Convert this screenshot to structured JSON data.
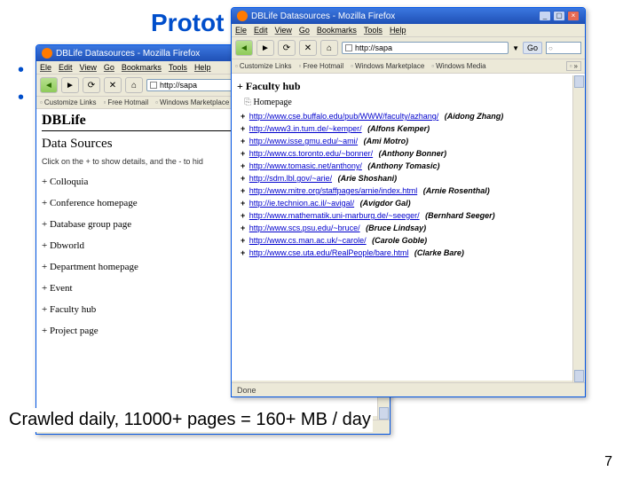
{
  "slide": {
    "title_fragment": "Protot",
    "crawl_text": "Crawled daily, 11000+ pages = 160+ MB / day",
    "page_number": "7"
  },
  "window_shared": {
    "title": "DBLife Datasources - Mozilla Firefox",
    "menu": [
      "Ele",
      "Edit",
      "View",
      "Go",
      "Bookmarks",
      "Tools",
      "Help"
    ],
    "url": "http://sapa",
    "go_label": "Go",
    "bookmarks": [
      "Customize Links",
      "Free Hotmail",
      "Windows Marketplace",
      "Windows Media"
    ],
    "expand": "»",
    "status": "Done"
  },
  "back_window": {
    "dblife": "DBLife",
    "heading": "Data Sources",
    "hint": "Click on the + to show details, and the - to hid",
    "items": [
      "+ Colloquia",
      "+ Conference homepage",
      "+ Database group page",
      "+ Dbworld",
      "+ Department homepage",
      "+ Event",
      "+ Faculty hub",
      "+ Project page"
    ]
  },
  "front_window": {
    "faculty_hub": "+ Faculty hub",
    "homepage": "Homepage",
    "links": [
      {
        "url": "http://www.cse.buffalo.edu/pub/WWW/faculty/azhang/",
        "who": "(Aidong Zhang)"
      },
      {
        "url": "http://www3.in.tum.de/~kemper/",
        "who": "(Alfons Kemper)"
      },
      {
        "url": "http://www.isse.gmu.edu/~ami/",
        "who": "(Ami Motro)"
      },
      {
        "url": "http://www.cs.toronto.edu/~bonner/",
        "who": "(Anthony Bonner)"
      },
      {
        "url": "http://www.tomasic.net/anthony/",
        "who": "(Anthony Tomasic)"
      },
      {
        "url": "http://sdm.lbl.gov/~arie/",
        "who": "(Arie Shoshani)"
      },
      {
        "url": "http://www.mitre.org/staffpages/arnie/index.html",
        "who": "(Arnie Rosenthal)"
      },
      {
        "url": "http://ie.technion.ac.il/~avigal/",
        "who": "(Avigdor Gal)"
      },
      {
        "url": "http://www.mathematik.uni-marburg.de/~seeger/",
        "who": "(Bernhard Seeger)"
      },
      {
        "url": "http://www.scs.psu.edu/~bruce/",
        "who": "(Bruce Lindsay)"
      },
      {
        "url": "http://www.cs.man.ac.uk/~carole/",
        "who": "(Carole Goble)"
      },
      {
        "url": "http://www.cse.uta.edu/RealPeople/bare.html",
        "who": "(Clarke Bare)"
      }
    ]
  }
}
